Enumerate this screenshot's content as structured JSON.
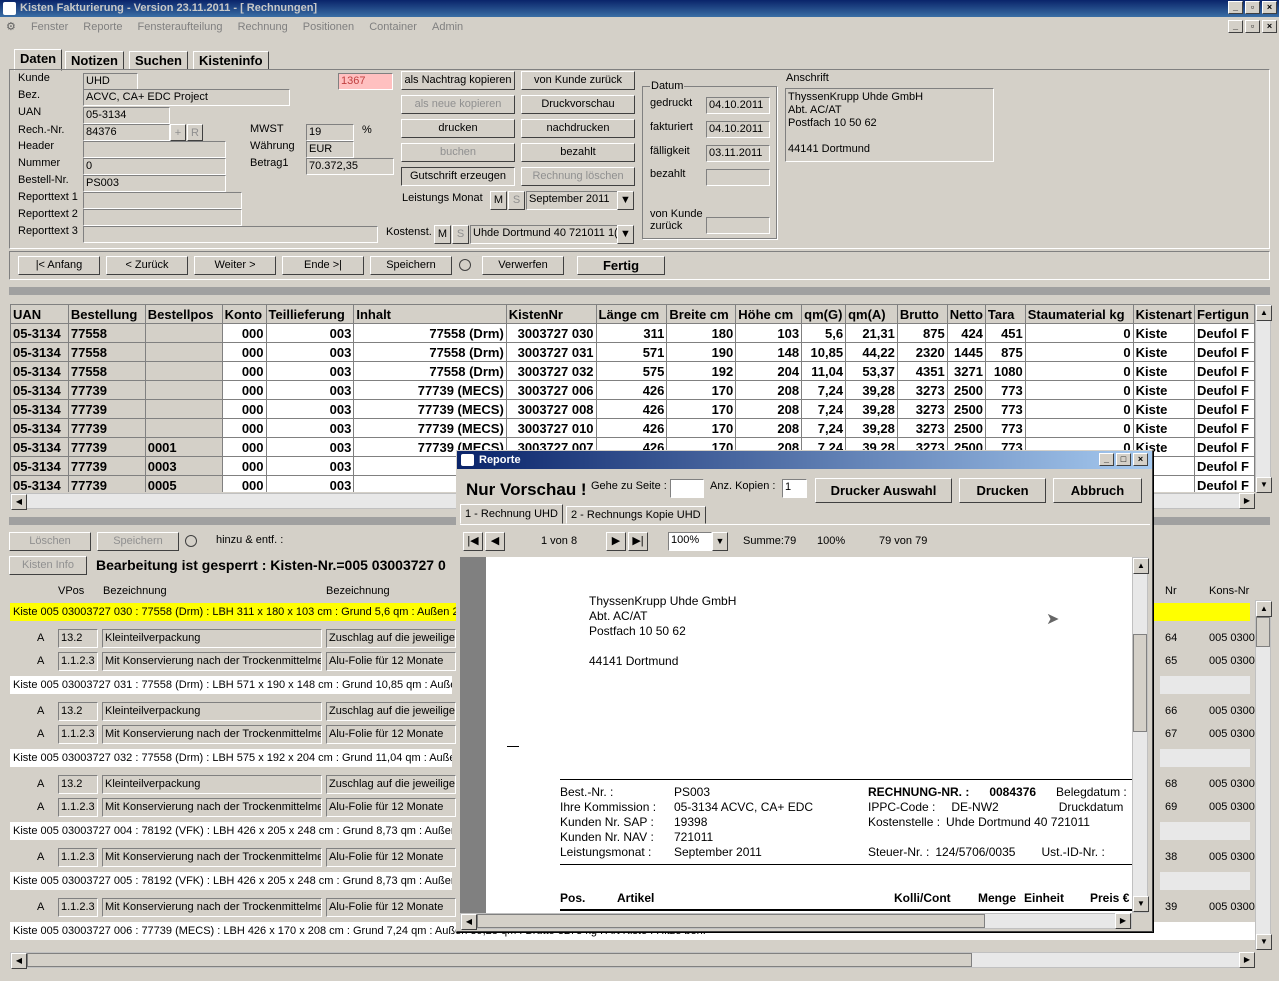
{
  "window": {
    "title": "Kisten Fakturierung - Version 23.11.2011 - [ Rechnungen]"
  },
  "menu": [
    "Fenster",
    "Reporte",
    "Fensteraufteilung",
    "Rechnung",
    "Positionen",
    "Container",
    "Admin"
  ],
  "tabs": [
    "Daten",
    "Notizen",
    "Suchen",
    "Kisteninfo"
  ],
  "form": {
    "kunde_label": "Kunde",
    "kunde": "UHD",
    "kunde_nr": "1367",
    "bez_label": "Bez.",
    "bez": "ACVC, CA+ EDC Project",
    "uan_label": "UAN",
    "uan": "05-3134",
    "rechnr_label": "Rech.-Nr.",
    "rechnr": "84376",
    "header_label": "Header",
    "nummer_label": "Nummer",
    "nummer": "0",
    "bestellnr_label": "Bestell-Nr.",
    "bestellnr": "PS003",
    "reporttext1_label": "Reporttext 1",
    "reporttext2_label": "Reporttext 2",
    "reporttext3_label": "Reporttext 3",
    "mwst_label": "MWST",
    "mwst": "19",
    "pct": "%",
    "waehrung_label": "Währung",
    "waehrung": "EUR",
    "betrag_label": "Betrag1",
    "betrag": "70.372,35",
    "leistungsmonat_label": "Leistungs Monat",
    "leistungsmonat": "September 2011",
    "kostenst_label": "Kostenst.",
    "kostenst": "Uhde Dortmund 40 721011 1(",
    "m": "M",
    "s": "S",
    "plus": "+",
    "r": "R"
  },
  "buttons": {
    "nachtrag": "als Nachtrag kopieren",
    "von_kunde": "von Kunde zurück",
    "neue_kopieren": "als neue kopieren",
    "druckvorschau": "Druckvorschau",
    "drucken": "drucken",
    "nachdrucken": "nachdrucken",
    "buchen": "buchen",
    "bezahlt": "bezahlt",
    "gutschrift": "Gutschrift erzeugen",
    "rechnung_loeschen": "Rechnung löschen"
  },
  "datum": {
    "legend": "Datum",
    "gedruckt_label": "gedruckt",
    "gedruckt": "04.10.2011",
    "fakturiert_label": "fakturiert",
    "fakturiert": "04.10.2011",
    "faelligkeit_label": "fälligkeit",
    "faelligkeit": "03.11.2011",
    "bezahlt_label": "bezahlt",
    "von_kunde_label": "von Kunde zurück"
  },
  "anschrift": {
    "label": "Anschrift",
    "lines": [
      "ThyssenKrupp Uhde GmbH",
      "Abt. AC/AT",
      "Postfach 10 50 62",
      "",
      "44141 Dortmund"
    ]
  },
  "nav": {
    "anfang": "|< Anfang",
    "zurueck": "< Zurück",
    "weiter": "Weiter >",
    "ende": "Ende >|",
    "speichern": "Speichern",
    "verwerfen": "Verwerfen",
    "fertig": "Fertig"
  },
  "table": {
    "headers": [
      "UAN",
      "Bestellung",
      "Bestellpos",
      "Konto",
      "Teillieferung",
      "Inhalt",
      "KistenNr",
      "Länge cm",
      "Breite cm",
      "Höhe cm",
      "qm(G)",
      "qm(A)",
      "Brutto",
      "Netto",
      "Tara",
      "Staumaterial kg",
      "Kistenart",
      "Fertigun"
    ],
    "rows": [
      [
        "05-3134",
        "77558",
        "",
        "000",
        "003",
        "77558 (Drm)",
        "3003727 030",
        "311",
        "180",
        "103",
        "5,6",
        "21,31",
        "875",
        "424",
        "451",
        "0",
        "Kiste",
        "Deufol F"
      ],
      [
        "05-3134",
        "77558",
        "",
        "000",
        "003",
        "77558 (Drm)",
        "3003727 031",
        "571",
        "190",
        "148",
        "10,85",
        "44,22",
        "2320",
        "1445",
        "875",
        "0",
        "Kiste",
        "Deufol F"
      ],
      [
        "05-3134",
        "77558",
        "",
        "000",
        "003",
        "77558 (Drm)",
        "3003727 032",
        "575",
        "192",
        "204",
        "11,04",
        "53,37",
        "4351",
        "3271",
        "1080",
        "0",
        "Kiste",
        "Deufol F"
      ],
      [
        "05-3134",
        "77739",
        "",
        "000",
        "003",
        "77739 (MECS)",
        "3003727 006",
        "426",
        "170",
        "208",
        "7,24",
        "39,28",
        "3273",
        "2500",
        "773",
        "0",
        "Kiste",
        "Deufol F"
      ],
      [
        "05-3134",
        "77739",
        "",
        "000",
        "003",
        "77739 (MECS)",
        "3003727 008",
        "426",
        "170",
        "208",
        "7,24",
        "39,28",
        "3273",
        "2500",
        "773",
        "0",
        "Kiste",
        "Deufol F"
      ],
      [
        "05-3134",
        "77739",
        "",
        "000",
        "003",
        "77739 (MECS)",
        "3003727 010",
        "426",
        "170",
        "208",
        "7,24",
        "39,28",
        "3273",
        "2500",
        "773",
        "0",
        "Kiste",
        "Deufol F"
      ],
      [
        "05-3134",
        "77739",
        "0001",
        "000",
        "003",
        "77739 (MECS)",
        "3003727 007",
        "426",
        "170",
        "208",
        "7,24",
        "39,28",
        "3273",
        "2500",
        "773",
        "0",
        "Kiste",
        "Deufol F"
      ],
      [
        "05-3134",
        "77739",
        "0003",
        "000",
        "003",
        "77739",
        "",
        "",
        "",
        "",
        "",
        "",
        "",
        "",
        "",
        "",
        "ste",
        "Deufol F"
      ],
      [
        "05-3134",
        "77739",
        "0005",
        "000",
        "003",
        "77739",
        "",
        "",
        "",
        "",
        "",
        "",
        "",
        "",
        "",
        "",
        "ste",
        "Deufol F"
      ]
    ]
  },
  "lower": {
    "loeschen": "Löschen",
    "speichern": "Speichern",
    "hinzu": "hinzu & entf. :",
    "kisten_info": "Kisten Info",
    "gesperrt": "Bearbeitung ist gesperrt : Kisten-Nr.=005 03003727 0",
    "col_vpos": "VPos",
    "col_bez1": "Bezeichnung",
    "col_bez2": "Bezeichnung",
    "col_nr": "Nr",
    "col_kons": "Kons-Nr",
    "kiste_lines": [
      "Kiste 005 03003727 030 : 77558 (Drm) : LBH 311 x 180 x 103 cm : Grund 5,6 qm : Außen 21",
      "Kiste 005 03003727 031 : 77558 (Drm) : LBH 571 x 190 x 148 cm : Grund 10,85 qm : Außen",
      "Kiste 005 03003727 032 : 77558 (Drm) : LBH 575 x 192 x 204 cm : Grund 11,04 qm : Außen",
      "Kiste 005 03003727 004 : 78192 (VFK) : LBH 426 x 205 x 248 cm : Grund 8,73 qm : Außen 4",
      "Kiste 005 03003727 005 : 78192 (VFK) : LBH 426 x 205 x 248 cm : Grund 8,73 qm : Außen 4",
      "Kiste 005 03003727 006 : 77739 (MECS) : LBH 426 x 170 x 208 cm : Grund 7,24 qm : Außen 39,28 qm : Brutto 3273 kg : Art Kiste : Hitze beh."
    ],
    "pos": [
      {
        "a": "A",
        "vpos": "13.2",
        "bez1": "Kleinteilverpackung",
        "bez2": "Zuschlag auf die jeweilige",
        "nr": "64",
        "kons": "005 0300"
      },
      {
        "a": "A",
        "vpos": "1.1.2.3",
        "bez1": "Mit Konservierung nach der Trockenmittelmet",
        "bez2": "Alu-Folie für 12 Monate",
        "nr": "65",
        "kons": "005 0300"
      },
      {
        "a": "A",
        "vpos": "13.2",
        "bez1": "Kleinteilverpackung",
        "bez2": "Zuschlag auf die jeweilige",
        "nr": "66",
        "kons": "005 0300"
      },
      {
        "a": "A",
        "vpos": "1.1.2.3",
        "bez1": "Mit Konservierung nach der Trockenmittelmet",
        "bez2": "Alu-Folie für 12 Monate",
        "nr": "67",
        "kons": "005 0300"
      },
      {
        "a": "A",
        "vpos": "13.2",
        "bez1": "Kleinteilverpackung",
        "bez2": "Zuschlag auf die jeweilige",
        "nr": "68",
        "kons": "005 0300"
      },
      {
        "a": "A",
        "vpos": "1.1.2.3",
        "bez1": "Mit Konservierung nach der Trockenmittelmet",
        "bez2": "Alu-Folie für 12 Monate",
        "nr": "69",
        "kons": "005 0300"
      },
      {
        "a": "A",
        "vpos": "1.1.2.3",
        "bez1": "Mit Konservierung nach der Trockenmittelmet",
        "bez2": "Alu-Folie für 12 Monate",
        "nr": "38",
        "kons": "005 0300"
      },
      {
        "a": "A",
        "vpos": "1.1.2.3",
        "bez1": "Mit Konservierung nach der Trockenmittelmet",
        "bez2": "Alu-Folie für 12 Monate",
        "nr": "39",
        "kons": "005 0300"
      }
    ]
  },
  "dialog": {
    "title": "Reporte",
    "nur_vorschau": "Nur Vorschau !",
    "gehe_label": "Gehe zu Seite :",
    "kopien_label": "Anz. Kopien :",
    "kopien": "1",
    "drucker_auswahl": "Drucker Auswahl",
    "drucken": "Drucken",
    "abbruch": "Abbruch",
    "tab1": "1 - Rechnung UHD",
    "tab2": "2 - Rechnungs Kopie UHD",
    "page": "1 von 8",
    "zoom": "100%",
    "summe": "Summe:79",
    "pct": "100%",
    "count": "79 von 79",
    "doc": {
      "address": [
        "ThyssenKrupp Uhde GmbH",
        "Abt. AC/AT",
        "Postfach 10 50 62",
        "",
        "44141 Dortmund"
      ],
      "best_label": "Best.-Nr. :",
      "best": "PS003",
      "komm_label": "Ihre Kommission :",
      "komm": "05-3134 ACVC, CA+ EDC",
      "sap_label": "Kunden Nr. SAP :",
      "sap": "19398",
      "nav_label": "Kunden Nr. NAV :",
      "nav": "721011",
      "lm_label": "Leistungsmonat :",
      "lm": "September 2011",
      "rech_label": "RECHNUNG-NR. :",
      "rech": "0084376",
      "belegdatum": "Belegdatum :",
      "ippc_label": "IPPC-Code :",
      "ippc": "DE-NW2",
      "druckdatum": "Druckdatum",
      "kst_label": "Kostenstelle :",
      "kst": "Uhde Dortmund 40 721011",
      "steuer_label": "Steuer-Nr. :",
      "steuer": "124/5706/0035",
      "ust_label": "Ust.-ID-Nr. :",
      "pos": "Pos.",
      "artikel": "Artikel",
      "kolli": "Kolli/Cont",
      "menge": "Menge",
      "einheit": "Einheit",
      "preis": "Preis €"
    }
  }
}
